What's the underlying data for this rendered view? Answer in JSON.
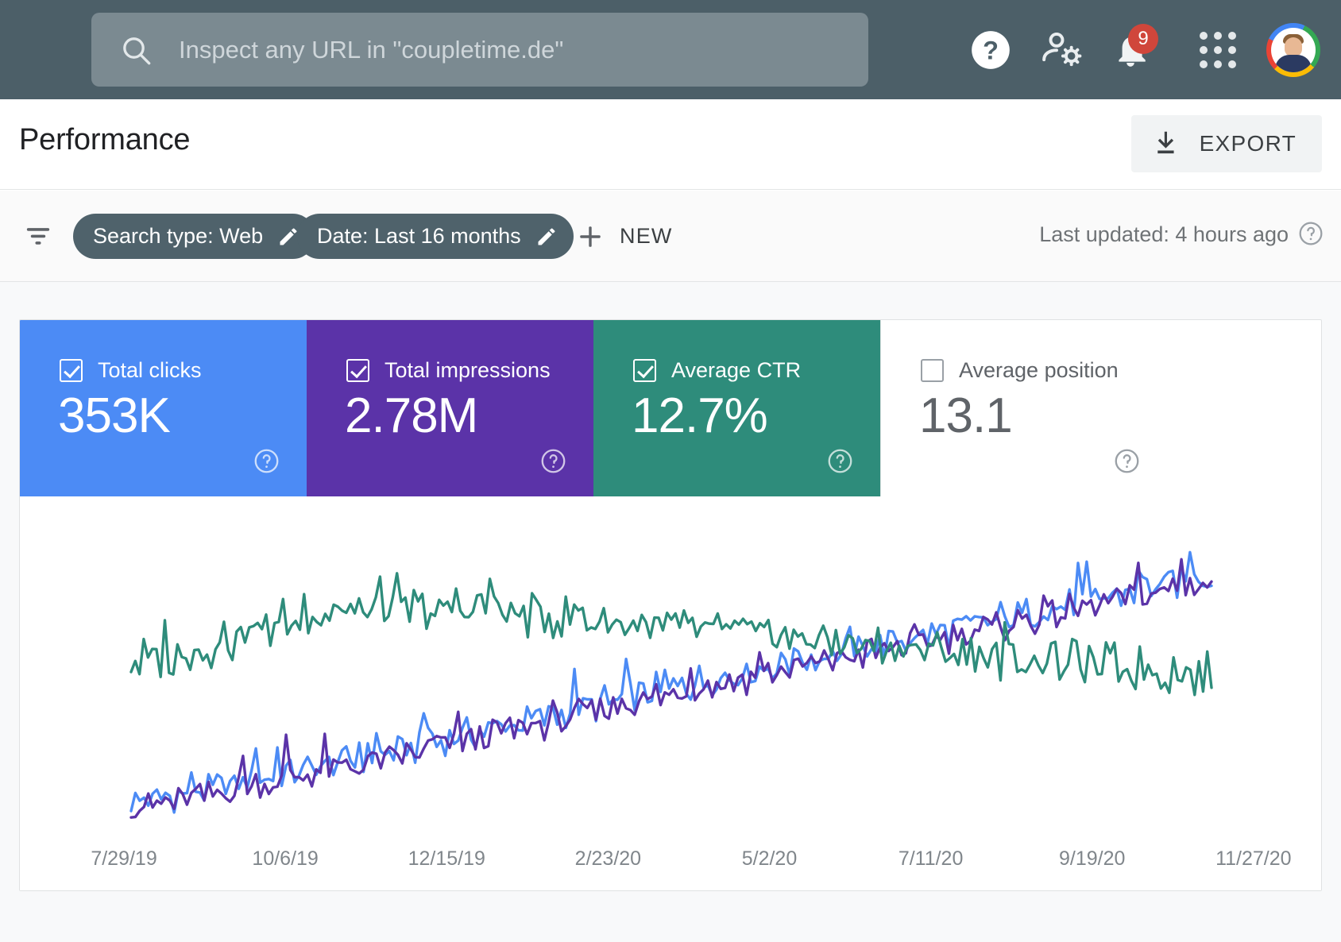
{
  "header": {
    "background_color": "#4C5F68",
    "search": {
      "icon": "search-icon",
      "placeholder": "Inspect any URL in \"coupletime.de\"",
      "value": ""
    },
    "icons": [
      {
        "name": "help-icon",
        "glyph": "?"
      },
      {
        "name": "user-settings-icon",
        "glyph": "person-gear"
      },
      {
        "name": "notifications-bell-icon",
        "glyph": "bell",
        "badge": "9",
        "badge_color": "#D0463B"
      },
      {
        "name": "google-apps-grid-icon",
        "glyph": "apps-3x3"
      },
      {
        "name": "account-avatar",
        "glyph": "avatar"
      }
    ]
  },
  "titlebar": {
    "title": "Performance",
    "export": {
      "label": "EXPORT",
      "icon": "download-icon"
    }
  },
  "filterbar": {
    "filter_icon": "filter-list-icon",
    "chips": [
      {
        "name": "chip-search-type",
        "label": "Search type: Web",
        "icon": "pencil-icon"
      },
      {
        "name": "chip-date",
        "label": "Date: Last 16 months",
        "icon": "pencil-icon"
      }
    ],
    "new_button": {
      "label": "NEW",
      "icon": "plus-icon"
    },
    "last_updated": "Last updated: 4 hours ago",
    "last_updated_help_icon": "help-circle-icon"
  },
  "metrics": [
    {
      "name": "metric-total-clicks",
      "label": "Total clicks",
      "value": "353K",
      "checked": true,
      "color": "#4C8BF5",
      "help_icon": "help-circle-icon"
    },
    {
      "name": "metric-total-impressions",
      "label": "Total impressions",
      "value": "2.78M",
      "checked": true,
      "color": "#5B33A8",
      "help_icon": "help-circle-icon"
    },
    {
      "name": "metric-average-ctr",
      "label": "Average CTR",
      "value": "12.7%",
      "checked": true,
      "color": "#2E8C7B",
      "help_icon": "help-circle-icon"
    },
    {
      "name": "metric-average-position",
      "label": "Average position",
      "value": "13.1",
      "checked": false,
      "color": "#FFFFFF",
      "help_icon": "help-circle-icon"
    }
  ],
  "chart_data": {
    "type": "line",
    "title": "Performance over time",
    "xlabel": "",
    "ylabel": "",
    "grid": false,
    "legend": "metric-tiles-above",
    "x_tick_labels": [
      "7/29/19",
      "10/6/19",
      "12/15/19",
      "2/23/20",
      "5/2/20",
      "7/11/20",
      "9/19/20",
      "11/27/20"
    ],
    "x_tick_positions_pct": [
      8.0,
      20.4,
      32.8,
      45.2,
      57.6,
      70.0,
      82.4,
      94.8
    ],
    "x_range": [
      "7/29/19",
      "11/27/20"
    ],
    "series": [
      {
        "name": "Total clicks",
        "color": "#4C8BF5",
        "values": [
          6,
          7,
          6,
          8,
          7,
          6,
          8,
          7,
          9,
          8,
          7,
          9,
          8,
          10,
          9,
          11,
          10,
          9,
          11,
          10,
          12,
          11,
          13,
          12,
          11,
          13,
          12,
          14,
          13,
          15,
          14,
          13,
          15,
          14,
          16,
          15,
          17,
          16,
          15,
          17,
          16,
          18,
          17,
          19,
          18,
          17,
          19,
          18,
          20,
          19,
          21,
          20,
          19,
          21,
          20,
          22,
          21,
          23,
          22,
          21,
          23,
          22,
          24,
          23,
          25,
          24,
          23,
          25,
          24,
          26,
          28,
          25,
          27,
          26,
          28,
          27,
          29,
          28,
          30,
          29,
          28,
          30,
          29,
          31,
          30,
          32,
          31,
          33,
          32,
          31,
          33,
          32,
          34,
          33,
          35,
          34,
          33,
          35,
          38,
          34,
          36,
          35,
          37,
          36,
          38,
          37,
          39,
          38,
          37,
          39,
          41,
          38,
          40,
          39,
          41,
          40,
          42,
          41,
          43,
          42,
          41,
          43,
          45,
          42,
          44,
          43,
          45,
          44,
          46,
          45,
          44,
          46,
          48,
          45,
          47,
          46,
          48,
          47,
          49,
          48,
          47,
          49,
          51,
          48,
          50,
          49,
          51,
          50,
          52,
          51,
          50,
          52,
          54,
          51,
          53,
          52,
          54,
          53,
          55,
          54,
          53,
          55,
          57,
          54,
          56,
          55,
          57,
          56,
          58,
          57,
          56,
          58,
          60,
          57,
          59,
          58,
          60,
          59,
          61,
          60,
          59,
          61,
          63,
          60,
          62,
          61,
          63,
          62,
          64,
          63,
          62,
          64,
          66,
          63,
          65,
          64,
          66,
          65,
          67,
          66,
          65,
          67,
          69,
          66,
          68,
          67,
          69,
          68,
          70,
          69,
          68,
          70,
          72,
          69,
          71,
          70,
          72,
          71,
          73,
          72,
          71,
          73,
          75,
          72,
          74,
          73,
          75,
          74,
          76,
          75,
          74,
          76,
          78,
          75,
          77,
          76,
          78,
          77,
          79,
          78,
          77,
          79,
          81,
          78,
          80,
          79,
          81,
          80,
          82,
          81,
          80,
          82
        ]
      },
      {
        "name": "Total impressions",
        "color": "#5B33A8",
        "values": [
          4,
          5,
          4,
          6,
          5,
          4,
          6,
          5,
          7,
          6,
          5,
          7,
          6,
          8,
          7,
          9,
          8,
          7,
          9,
          8,
          10,
          9,
          11,
          10,
          9,
          11,
          10,
          12,
          11,
          13,
          12,
          11,
          13,
          12,
          14,
          13,
          15,
          14,
          13,
          15,
          14,
          16,
          15,
          17,
          16,
          15,
          17,
          16,
          18,
          17,
          19,
          18,
          17,
          19,
          18,
          20,
          19,
          21,
          20,
          19,
          21,
          20,
          22,
          21,
          23,
          22,
          21,
          23,
          22,
          24,
          26,
          23,
          25,
          24,
          26,
          25,
          27,
          26,
          28,
          27,
          26,
          28,
          27,
          29,
          28,
          30,
          29,
          31,
          30,
          29,
          31,
          30,
          32,
          31,
          33,
          32,
          31,
          33,
          36,
          32,
          34,
          33,
          35,
          34,
          36,
          35,
          37,
          36,
          35,
          37,
          39,
          36,
          38,
          37,
          39,
          38,
          40,
          39,
          41,
          40,
          39,
          41,
          43,
          40,
          42,
          41,
          43,
          42,
          44,
          43,
          42,
          44,
          46,
          43,
          45,
          44,
          46,
          45,
          47,
          46,
          45,
          47,
          49,
          46,
          48,
          47,
          49,
          48,
          50,
          49,
          48,
          50,
          52,
          49,
          51,
          50,
          52,
          51,
          53,
          52,
          51,
          53,
          55,
          52,
          54,
          53,
          55,
          54,
          56,
          55,
          54,
          56,
          58,
          55,
          57,
          56,
          58,
          57,
          59,
          58,
          57,
          59,
          61,
          58,
          60,
          59,
          61,
          60,
          62,
          61,
          60,
          62,
          64,
          61,
          63,
          62,
          64,
          63,
          65,
          64,
          63,
          65,
          67,
          64,
          66,
          65,
          67,
          66,
          68,
          67,
          66,
          68,
          70,
          67,
          69,
          68,
          70,
          69,
          71,
          70,
          69,
          71,
          73,
          70,
          72,
          71,
          73,
          72,
          74,
          73,
          72,
          74,
          76,
          73,
          75,
          74,
          76,
          75,
          77,
          76,
          75,
          77,
          79,
          76,
          78,
          77,
          79,
          78,
          80,
          79,
          78,
          80
        ]
      },
      {
        "name": "Average CTR",
        "color": "#2E8C7B",
        "values": [
          52,
          54,
          51,
          56,
          53,
          50,
          55,
          52,
          57,
          54,
          51,
          56,
          53,
          58,
          55,
          60,
          57,
          54,
          59,
          56,
          61,
          58,
          63,
          60,
          57,
          62,
          59,
          64,
          61,
          66,
          63,
          60,
          65,
          62,
          67,
          64,
          69,
          66,
          63,
          68,
          65,
          70,
          67,
          72,
          69,
          66,
          71,
          68,
          73,
          70,
          72,
          69,
          71,
          68,
          70,
          67,
          72,
          69,
          74,
          71,
          68,
          73,
          70,
          72,
          69,
          71,
          68,
          73,
          70,
          72,
          69,
          71,
          68,
          70,
          67,
          72,
          69,
          74,
          71,
          68,
          73,
          70,
          72,
          69,
          71,
          73,
          70,
          72,
          69,
          71,
          68,
          70,
          67,
          69,
          66,
          71,
          68,
          70,
          67,
          69,
          66,
          68,
          65,
          70,
          67,
          69,
          66,
          68,
          65,
          67,
          64,
          69,
          66,
          68,
          65,
          67,
          64,
          66,
          63,
          68,
          65,
          67,
          64,
          66,
          63,
          65,
          62,
          67,
          64,
          66,
          63,
          65,
          62,
          64,
          61,
          66,
          63,
          65,
          62,
          64,
          61,
          63,
          60,
          65,
          62,
          64,
          61,
          63,
          60,
          62,
          59,
          64,
          61,
          63,
          60,
          62,
          59,
          61,
          58,
          63,
          60,
          62,
          59,
          61,
          58,
          60,
          57,
          62,
          59,
          61,
          58,
          60,
          57,
          59,
          56,
          61,
          58,
          60,
          57,
          59,
          56,
          58,
          55,
          60,
          57,
          59,
          56,
          58,
          55,
          57,
          54,
          59,
          56,
          58,
          55,
          57,
          54,
          56,
          53,
          58,
          55,
          57,
          54,
          56,
          53,
          55,
          52,
          57,
          54,
          56,
          53,
          55,
          52,
          54,
          51,
          56,
          53,
          55,
          52,
          54,
          51,
          53,
          50,
          55,
          52,
          54,
          51,
          53,
          50,
          52,
          49,
          54,
          51,
          53,
          50,
          52,
          49,
          51,
          48,
          53,
          50,
          52,
          49,
          51,
          48,
          50,
          47,
          52,
          49,
          51,
          48,
          50,
          47,
          49,
          46,
          51,
          48
        ]
      }
    ]
  }
}
